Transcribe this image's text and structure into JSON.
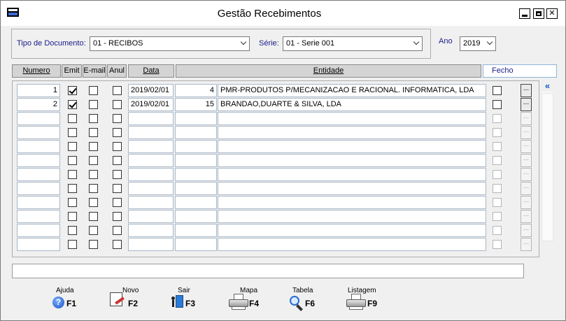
{
  "window": {
    "title": "Gestão Recebimentos",
    "controls": [
      "minimize",
      "maximize",
      "close"
    ]
  },
  "filters": {
    "tipo_documento_label": "Tipo de Documento:",
    "tipo_documento_value": "01 - RECIBOS",
    "serie_label": "Série:",
    "serie_value": "01 - Serie 001",
    "ano_label": "Ano",
    "ano_value": "2019"
  },
  "grid": {
    "headers": {
      "numero": "Numero",
      "emit": "Emit",
      "email": "E-mail",
      "anul": "Anul",
      "data": "Data",
      "entidade": "Entidade",
      "fecho": "Fecho"
    },
    "rows": [
      {
        "numero": "1",
        "emit": true,
        "email": false,
        "anul": false,
        "data": "2019/02/01",
        "entidade_num": "4",
        "entidade": "PMR-PRODUTOS P/MECANIZACAO E      RACIONAL. INFORMATICA, LDA",
        "fecho": false
      },
      {
        "numero": "2",
        "emit": true,
        "email": false,
        "anul": false,
        "data": "2019/02/01",
        "entidade_num": "15",
        "entidade": "BRANDAO,DUARTE & SILVA, LDA",
        "fecho": false
      },
      {
        "numero": "",
        "emit": false,
        "email": false,
        "anul": false,
        "data": "",
        "entidade_num": "",
        "entidade": "",
        "fecho": false
      },
      {
        "numero": "",
        "emit": false,
        "email": false,
        "anul": false,
        "data": "",
        "entidade_num": "",
        "entidade": "",
        "fecho": false
      },
      {
        "numero": "",
        "emit": false,
        "email": false,
        "anul": false,
        "data": "",
        "entidade_num": "",
        "entidade": "",
        "fecho": false
      },
      {
        "numero": "",
        "emit": false,
        "email": false,
        "anul": false,
        "data": "",
        "entidade_num": "",
        "entidade": "",
        "fecho": false
      },
      {
        "numero": "",
        "emit": false,
        "email": false,
        "anul": false,
        "data": "",
        "entidade_num": "",
        "entidade": "",
        "fecho": false
      },
      {
        "numero": "",
        "emit": false,
        "email": false,
        "anul": false,
        "data": "",
        "entidade_num": "",
        "entidade": "",
        "fecho": false
      },
      {
        "numero": "",
        "emit": false,
        "email": false,
        "anul": false,
        "data": "",
        "entidade_num": "",
        "entidade": "",
        "fecho": false
      },
      {
        "numero": "",
        "emit": false,
        "email": false,
        "anul": false,
        "data": "",
        "entidade_num": "",
        "entidade": "",
        "fecho": false
      },
      {
        "numero": "",
        "emit": false,
        "email": false,
        "anul": false,
        "data": "",
        "entidade_num": "",
        "entidade": "",
        "fecho": false
      },
      {
        "numero": "",
        "emit": false,
        "email": false,
        "anul": false,
        "data": "",
        "entidade_num": "",
        "entidade": "",
        "fecho": false
      }
    ],
    "ellipsis_label": "..."
  },
  "toolbar": {
    "ajuda": {
      "caption": "Ajuda",
      "key": "F1",
      "icon": "help-icon"
    },
    "novo": {
      "caption": "Novo",
      "key": "F2",
      "icon": "new-document-icon"
    },
    "sair": {
      "caption": "Sair",
      "key": "F3",
      "icon": "exit-icon"
    },
    "mapa": {
      "caption": "Mapa",
      "key": "F4",
      "icon": "printer-icon"
    },
    "tabela": {
      "caption": "Tabela",
      "key": "F6",
      "icon": "magnifier-icon"
    },
    "listagem": {
      "caption": "Listagem",
      "key": "F9",
      "icon": "printer-icon"
    }
  },
  "scroll": {
    "collapse_glyph": "«"
  }
}
